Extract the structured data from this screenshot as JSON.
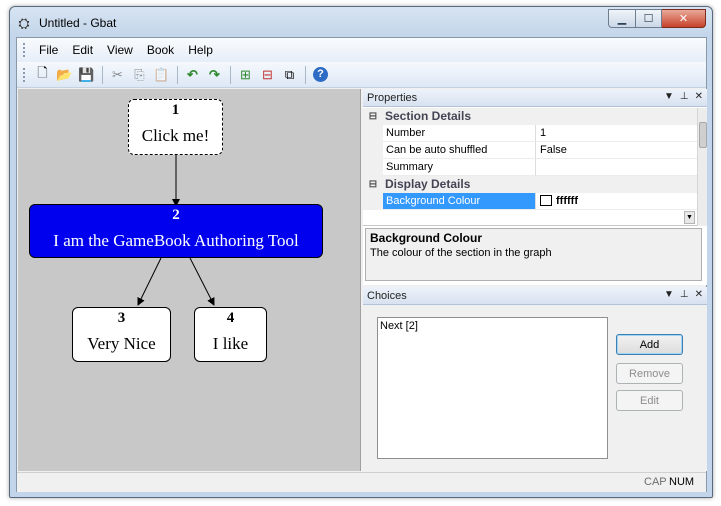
{
  "window": {
    "app_icon": "gamebook-icon",
    "title": "Untitled - Gbat",
    "controls": {
      "minimize": "▁",
      "maximize": "☐",
      "close": "✕"
    }
  },
  "menu": [
    "File",
    "Edit",
    "View",
    "Book",
    "Help"
  ],
  "toolbar": [
    {
      "name": "new-icon",
      "glyph": "🗋"
    },
    {
      "name": "open-icon",
      "glyph": "📂"
    },
    {
      "name": "save-icon",
      "glyph": "💾"
    },
    {
      "name": "cut-icon",
      "glyph": "✂"
    },
    {
      "name": "copy-icon",
      "glyph": "⎘"
    },
    {
      "name": "paste-icon",
      "glyph": "📋"
    },
    {
      "name": "undo-icon",
      "glyph": "↶"
    },
    {
      "name": "redo-icon",
      "glyph": "↷"
    },
    {
      "name": "add-section-icon",
      "glyph": "⊞"
    },
    {
      "name": "delete-section-icon",
      "glyph": "⊟"
    },
    {
      "name": "link-sections-icon",
      "glyph": "⧉"
    },
    {
      "name": "help-icon",
      "glyph": "?"
    }
  ],
  "graph": {
    "nodes": [
      {
        "number": "1",
        "text": "Click me!"
      },
      {
        "number": "2",
        "text": "I am the GameBook Authoring Tool"
      },
      {
        "number": "3",
        "text": "Very Nice"
      },
      {
        "number": "4",
        "text": "I like"
      }
    ],
    "selected_fill": "#0000ee"
  },
  "properties": {
    "header": "Properties",
    "categories": [
      {
        "label": "Section Details",
        "rows": [
          {
            "name": "Number",
            "value": "1"
          },
          {
            "name": "Can be auto shuffled",
            "value": "False"
          },
          {
            "name": "Summary",
            "value": ""
          }
        ]
      },
      {
        "label": "Display Details",
        "rows": [
          {
            "name": "Background Colour",
            "value": "ffffff"
          }
        ]
      }
    ],
    "help_title": "Background Colour",
    "help_text": "The colour of the section in the graph"
  },
  "choices": {
    "header": "Choices",
    "items": [
      "Next [2]"
    ],
    "buttons": {
      "add": "Add",
      "remove": "Remove",
      "edit": "Edit"
    }
  },
  "status": {
    "cap": "CAP",
    "num": "NUM"
  }
}
